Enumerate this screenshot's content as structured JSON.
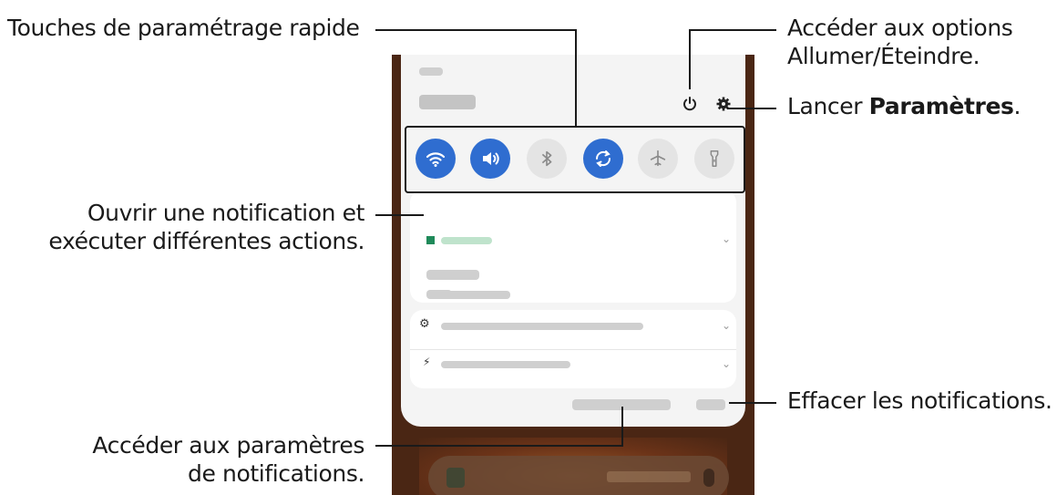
{
  "callouts": {
    "quick_settings": "Touches de paramétrage rapide",
    "power_options_line1": "Accéder aux options",
    "power_options_line2": "Allumer/Éteindre.",
    "settings_prefix": "Lancer ",
    "settings_bold": "Paramètres",
    "settings_suffix": ".",
    "open_notification_line1": "Ouvrir une notification et",
    "open_notification_line2": "exécuter différentes actions.",
    "notification_settings_line1": "Accéder aux paramètres",
    "notification_settings_line2": "de notifications.",
    "clear_notifications": "Effacer les notifications."
  },
  "phone": {
    "quick_settings": [
      {
        "icon": "wifi-icon",
        "state": "on"
      },
      {
        "icon": "sound-icon",
        "state": "on"
      },
      {
        "icon": "bluetooth-icon",
        "state": "off"
      },
      {
        "icon": "auto-rotate-icon",
        "state": "on"
      },
      {
        "icon": "airplane-mode-icon",
        "state": "off"
      },
      {
        "icon": "flashlight-icon",
        "state": "off"
      }
    ],
    "header_icons": [
      "power-icon",
      "settings-gear-icon"
    ],
    "colors": {
      "toggle_on": "#2f6dd0",
      "toggle_off": "#e4e4e4",
      "shade_bg": "#f4f4f4",
      "wallpaper": "#4a2614"
    }
  }
}
